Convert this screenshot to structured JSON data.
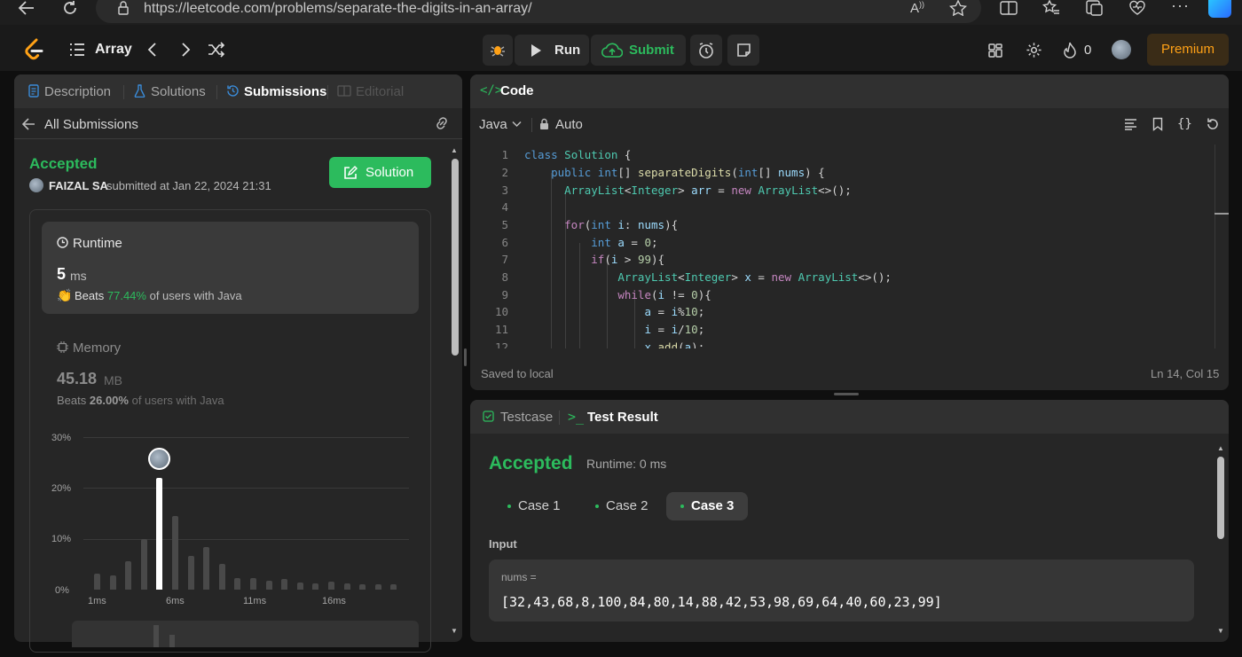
{
  "browser": {
    "url": "https://leetcode.com/problems/separate-the-digits-in-an-array/"
  },
  "header": {
    "problem_list": "Array",
    "run": "Run",
    "submit": "Submit",
    "streak": "0",
    "premium": "Premium"
  },
  "left_panel": {
    "tabs": [
      "Description",
      "Solutions",
      "Submissions",
      "Editorial"
    ],
    "all_submissions": "All Submissions",
    "status": "Accepted",
    "user": "FAIZAL SA",
    "submitted_text": "submitted at Jan 22, 2024 21:31",
    "solution_button": "Solution",
    "runtime": {
      "title": "Runtime",
      "value": "5",
      "unit": "ms",
      "beats_label": "Beats",
      "beats_pct": "77.44%",
      "beats_suffix": "of users with Java"
    },
    "memory": {
      "title": "Memory",
      "value": "45.18",
      "unit": "MB",
      "beats_label": "Beats",
      "beats_pct": "26.00%",
      "beats_suffix": "of users with Java"
    }
  },
  "chart_data": {
    "type": "bar",
    "y_ticks": [
      "30%",
      "20%",
      "10%",
      "0%"
    ],
    "x_ticks": [
      "1ms",
      "6ms",
      "11ms",
      "16ms"
    ],
    "ylim": [
      0,
      30
    ],
    "values": [
      3.2,
      2.8,
      5.6,
      10,
      22,
      14.4,
      6.6,
      8.4,
      5,
      2.3,
      2.2,
      1.7,
      2.1,
      1.4,
      1.3,
      1.6,
      1.2,
      1.1,
      1.1,
      1.1
    ],
    "highlight_index": 4
  },
  "code_panel": {
    "title": "Code",
    "language": "Java",
    "mode": "Auto",
    "saved": "Saved to local",
    "cursor": "Ln 14, Col 15",
    "line_numbers": [
      "1",
      "2",
      "3",
      "4",
      "5",
      "6",
      "7",
      "8",
      "9",
      "10",
      "11",
      "12"
    ]
  },
  "result_panel": {
    "tabs": [
      "Testcase",
      "Test Result"
    ],
    "status": "Accepted",
    "runtime": "Runtime: 0 ms",
    "cases": [
      "Case 1",
      "Case 2",
      "Case 3"
    ],
    "input_label": "Input",
    "param_name": "nums =",
    "param_value": "[32,43,68,8,100,84,80,14,88,42,53,98,69,64,40,60,23,99]"
  },
  "colors": {
    "accent_green": "#2cbb5d",
    "premium": "#ffa116",
    "link_blue": "#3a8bd8"
  }
}
